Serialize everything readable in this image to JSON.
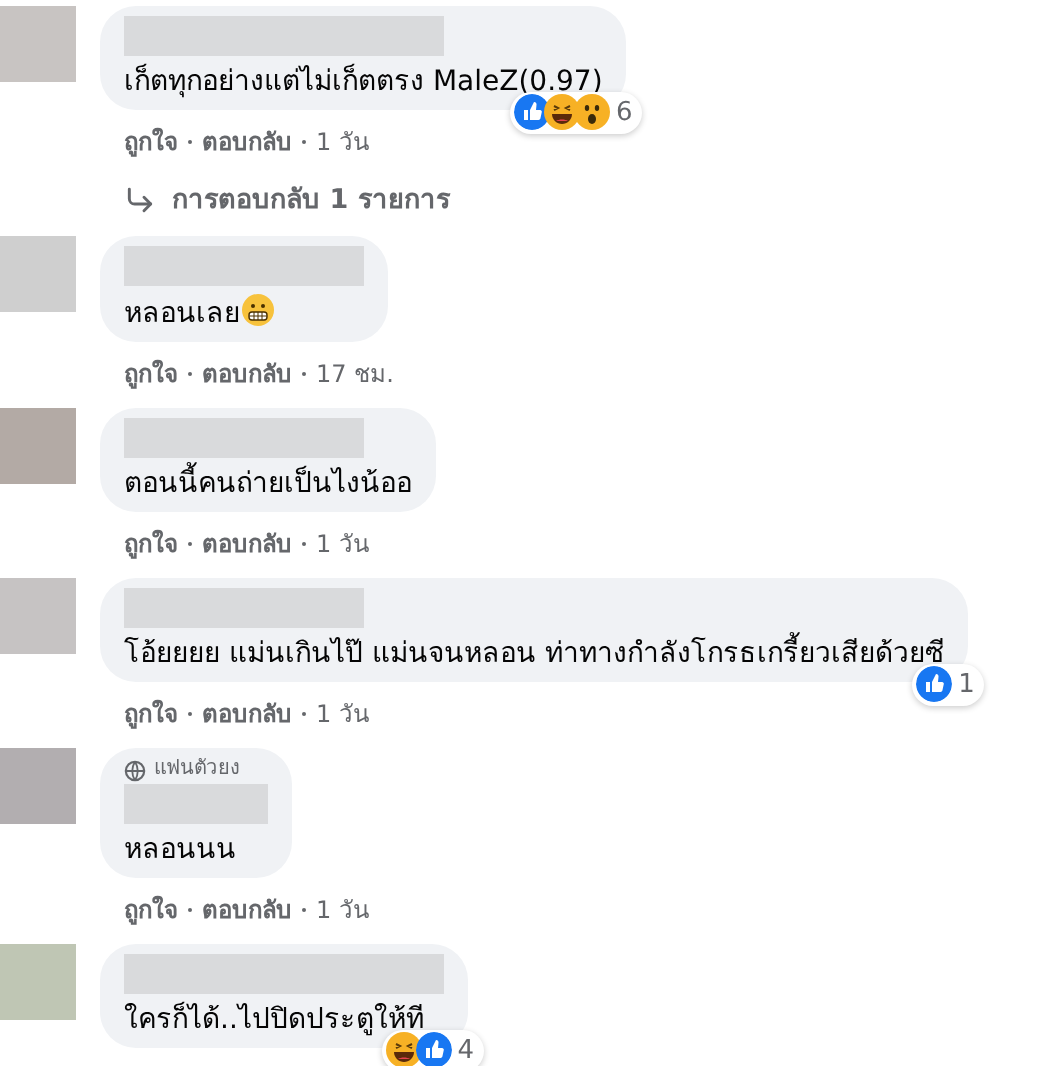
{
  "comments": [
    {
      "text": "เก็ตทุกอย่างแต่ไม่เก็ตตรง MaleZ(0.97)",
      "reactions": [
        {
          "kind": "like"
        },
        {
          "kind": "haha"
        },
        {
          "kind": "wow"
        }
      ],
      "reaction_count": "6",
      "actions": [
        "ถูกใจ",
        "ตอบกลับ",
        "1 วัน"
      ],
      "replies_link": "การตอบกลับ 1 รายการ"
    },
    {
      "text": "หลอนเลย",
      "trailing_emoji": true,
      "actions": [
        "ถูกใจ",
        "ตอบกลับ",
        "17 ชม."
      ]
    },
    {
      "text": "ตอนนี้คนถ่ายเป็นไงน้ออ",
      "actions": [
        "ถูกใจ",
        "ตอบกลับ",
        "1 วัน"
      ]
    },
    {
      "text": "โอ้ยยยย แม่นเกินไป๊ แม่นจนหลอน ท่าทางกำลังโกรธเกรี้ยวเสียด้วยซี",
      "reactions": [
        {
          "kind": "like"
        }
      ],
      "reaction_count": "1",
      "actions": [
        "ถูกใจ",
        "ตอบกลับ",
        "1 วัน"
      ]
    },
    {
      "badge": "แฟนตัวยง",
      "text": "หลอนนน",
      "actions": [
        "ถูกใจ",
        "ตอบกลับ",
        "1 วัน"
      ]
    },
    {
      "text": "ใครก็ได้..ไปปิดประตูให้ที",
      "reactions": [
        {
          "kind": "haha"
        },
        {
          "kind": "like"
        }
      ],
      "reaction_count": "4"
    }
  ]
}
